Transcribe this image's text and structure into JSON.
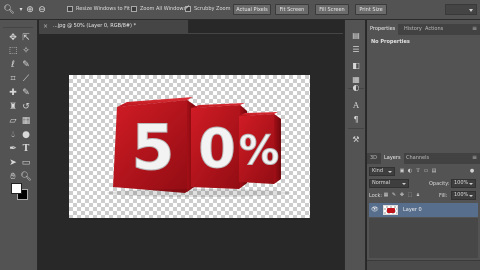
{
  "options_bar": {
    "resize_windows_label": "Resize Windows to Fit",
    "resize_windows_checked": false,
    "zoom_all_label": "Zoom All Windows",
    "zoom_all_checked": false,
    "scrubby_zoom_label": "Scrubby Zoom",
    "scrubby_zoom_checked": true,
    "actual_pixels_label": "Actual Pixels",
    "fit_screen_label": "Fit Screen",
    "fill_screen_label": "Fill Screen",
    "print_size_label": "Print Size"
  },
  "document": {
    "tab_title": "...jpg @ 50% (Layer 0, RGB/8#) *",
    "tab_close": "×",
    "artwork_text": [
      "5",
      "0",
      "%"
    ],
    "block_color": "#c41821",
    "text_color": "#f3f3f3"
  },
  "toolbar": {
    "foreground_color": "#ffffff",
    "background_color": "#000000"
  },
  "properties_panel": {
    "tabs": [
      "Properties",
      "History",
      "Actions"
    ],
    "active_tab": "Properties",
    "empty_text": "No Properties"
  },
  "layers_panel": {
    "tabs": [
      "3D",
      "Layers",
      "Channels"
    ],
    "active_tab": "Layers",
    "filter_kind": "Kind",
    "blend_mode": "Normal",
    "opacity_label": "Opacity:",
    "opacity_value": "100%",
    "lock_label": "Lock:",
    "fill_label": "Fill:",
    "fill_value": "100%",
    "layers": [
      {
        "name": "Layer 0",
        "visible": true,
        "selected": true
      }
    ]
  },
  "colors": {
    "ui_panel": "#535353",
    "ui_dark": "#282828",
    "selection": "#576e8d"
  }
}
